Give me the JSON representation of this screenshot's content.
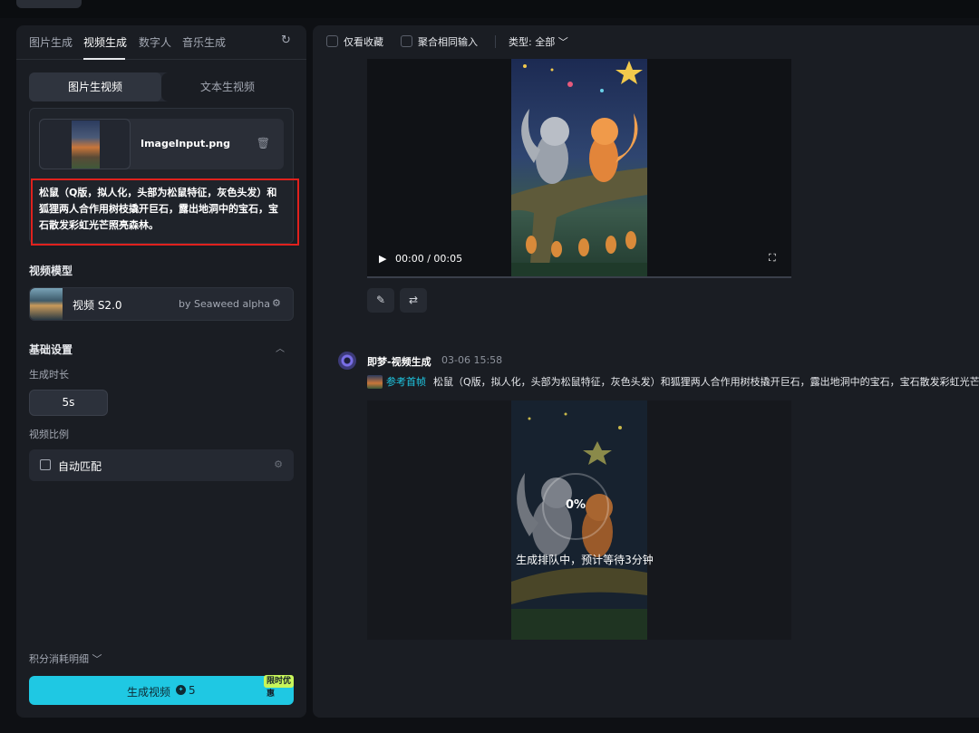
{
  "left": {
    "tabs": [
      "图片生成",
      "视频生成",
      "数字人",
      "音乐生成"
    ],
    "active_tab": "视频生成",
    "mode": {
      "image_to_video": "图片生视频",
      "text_to_video": "文本生视频"
    },
    "file_name": "ImageInput.png",
    "prompt": "松鼠（Q版，拟人化，头部为松鼠特征，灰色头发）和狐狸两人合作用树枝撬开巨石，露出地洞中的宝石，宝石散发彩虹光芒照亮森林。",
    "model_section": "视频模型",
    "model_name": "视频 S2.0",
    "model_by": "by Seaweed alpha",
    "basic_settings": "基础设置",
    "duration_label": "生成时长",
    "duration_value": "5s",
    "ratio_label": "视频比例",
    "ratio_value": "自动匹配",
    "points_detail": "积分消耗明细",
    "generate_label": "生成视频",
    "generate_cost": "5",
    "promo": "限时优惠"
  },
  "right": {
    "filter_fav": "仅看收藏",
    "filter_merge": "聚合相同输入",
    "filter_type": "类型: 全部",
    "video_time": "00:00",
    "video_duration": "00:05",
    "message_title": "即梦-视频生成",
    "message_time": "03-06  15:58",
    "ref_tag": "参考首帧",
    "ref_text": "松鼠（Q版，拟人化，头部为松鼠特征，灰色头发）和狐狸两人合作用树枝撬开巨石，露出地洞中的宝石，宝石散发彩虹光芒照亮森林。",
    "progress": "0%",
    "queue_text": "生成排队中，预计等待3分钟"
  },
  "icons": [
    "refresh-icon",
    "trash-icon",
    "adjust-icon",
    "chevron-up-icon",
    "chevron-down-icon",
    "play-icon",
    "fullscreen-icon",
    "edit-icon",
    "regenerate-icon",
    "coin-icon",
    "ratio-icon"
  ]
}
